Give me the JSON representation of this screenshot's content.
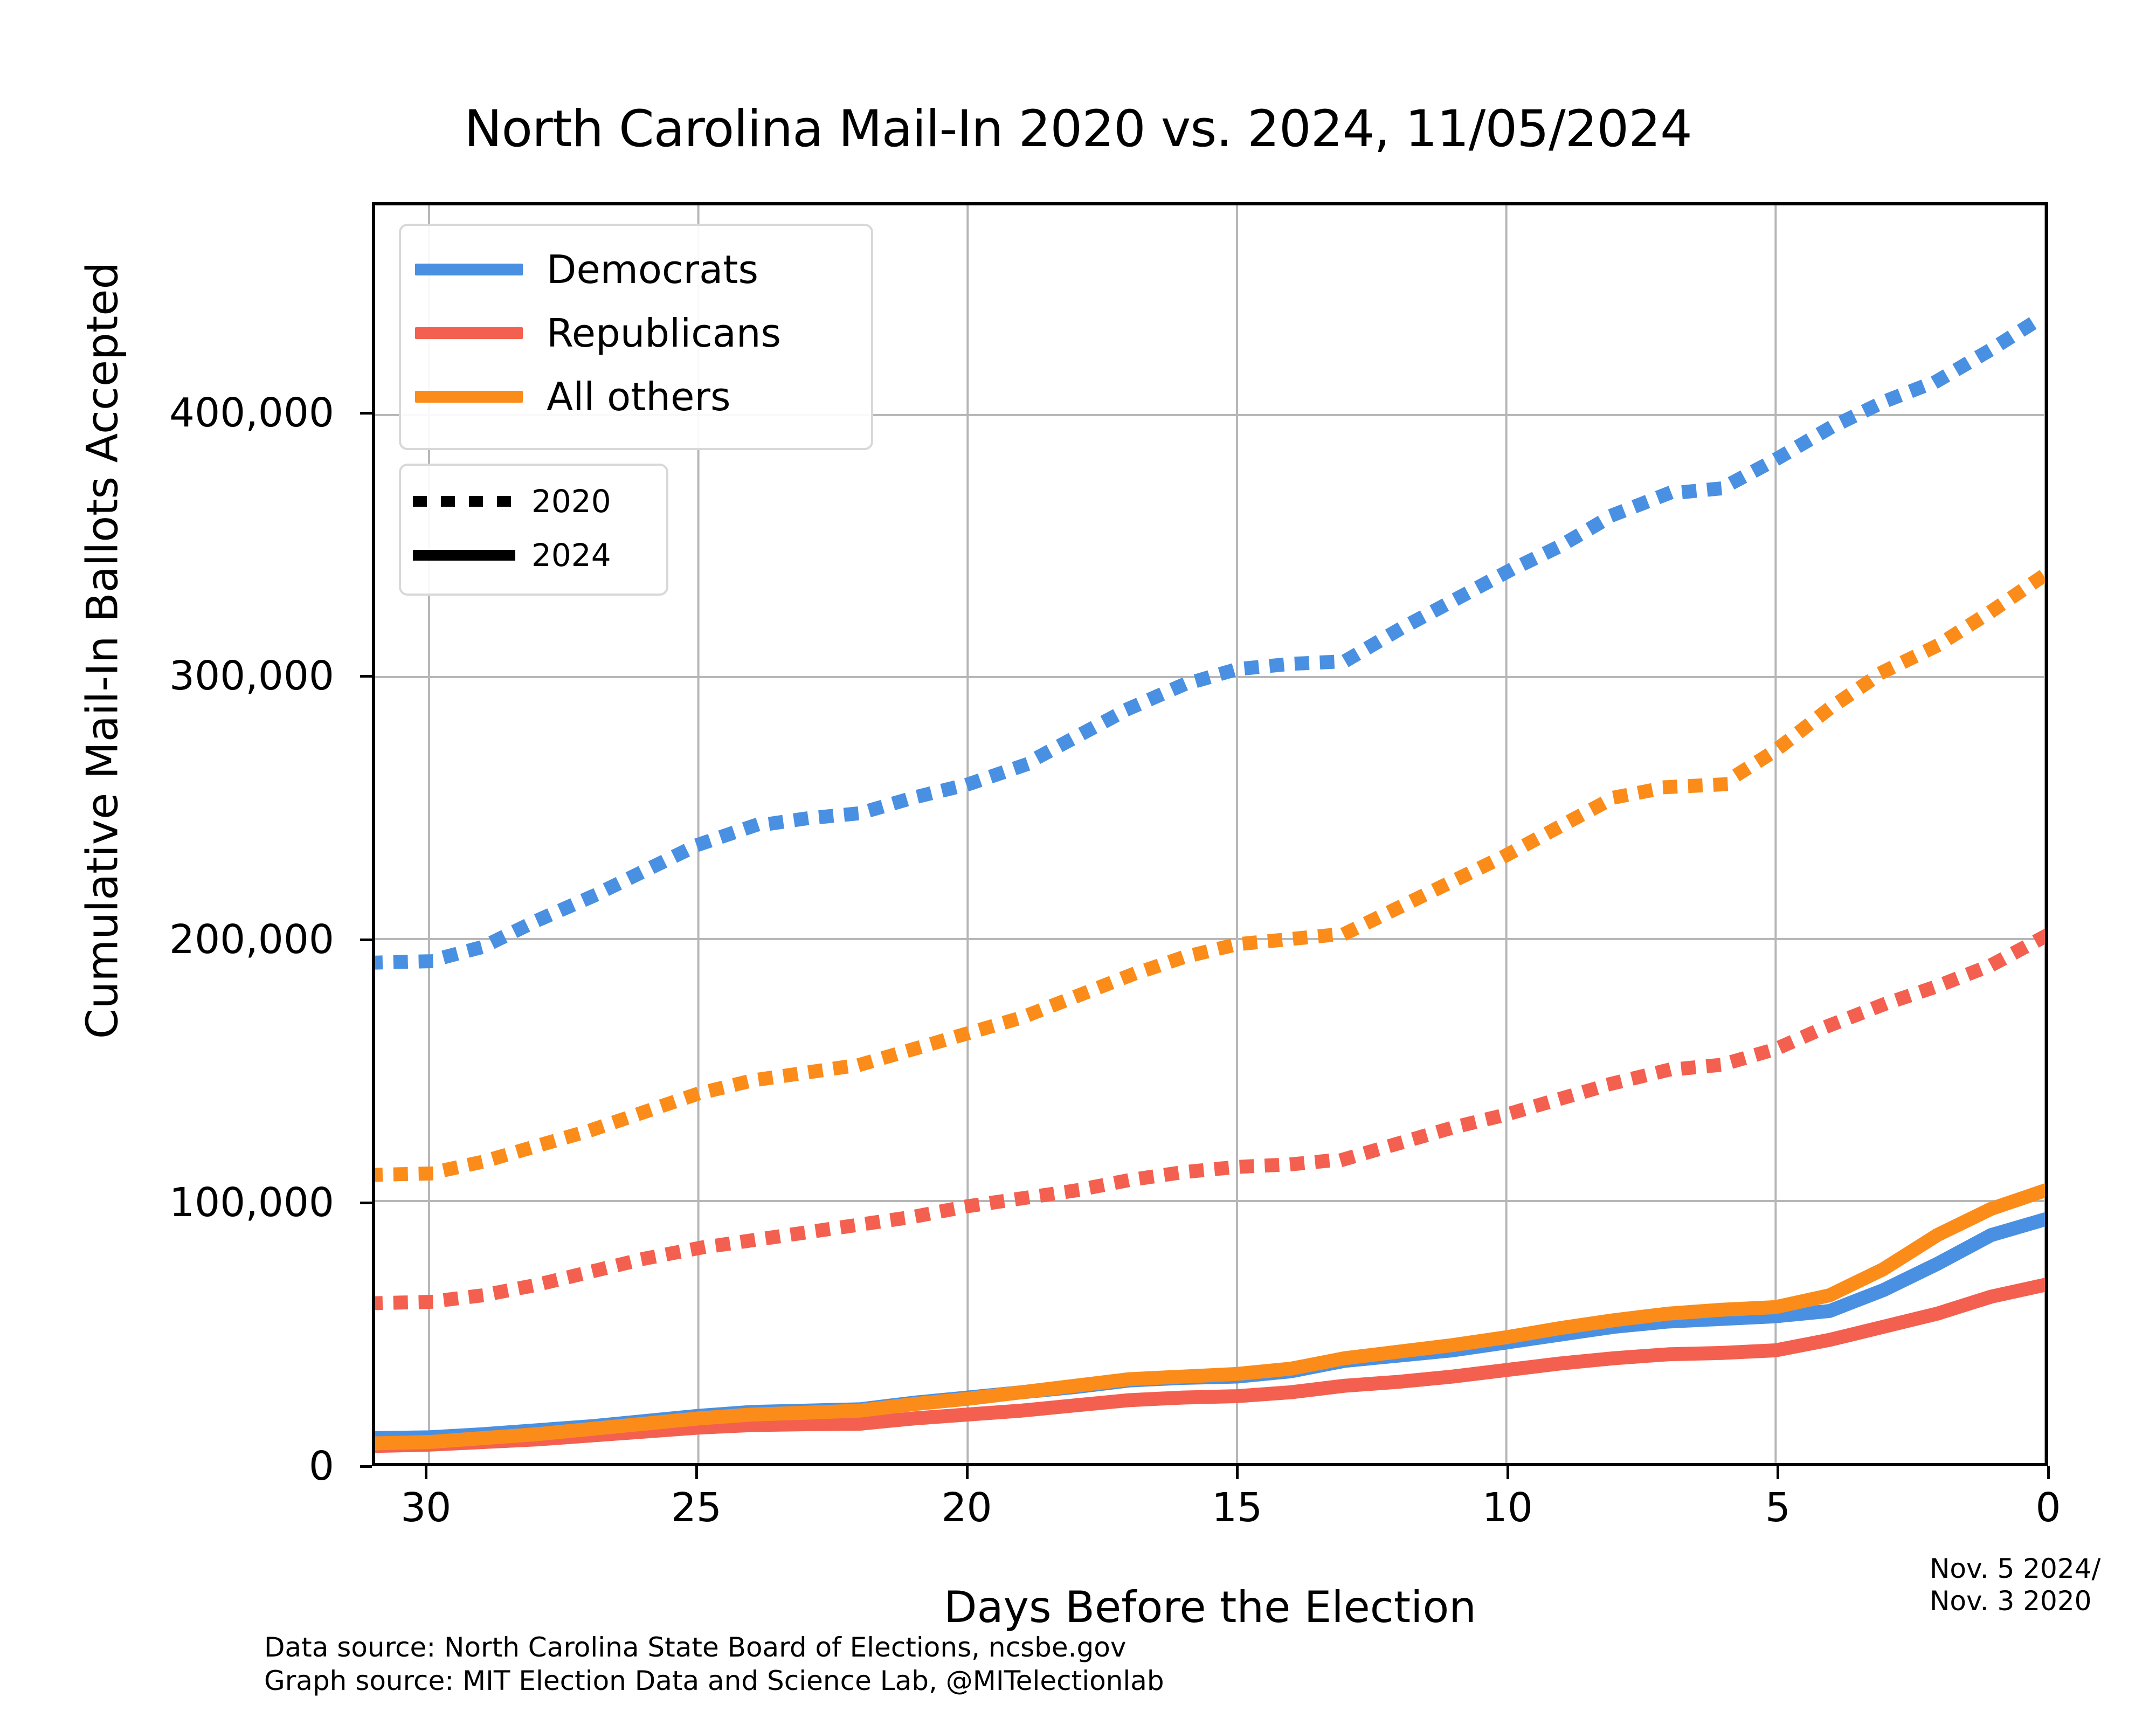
{
  "title": "North Carolina Mail-In 2020 vs. 2024, 11/05/2024",
  "axes": {
    "ylabel": "Cumulative Mail-In Ballots Accepted",
    "xlabel": "Days Before the Election"
  },
  "legend_color": {
    "items": [
      {
        "label": "Democrats",
        "color": "#4a90e2"
      },
      {
        "label": "Republicans",
        "color": "#f4604f"
      },
      {
        "label": "All others",
        "color": "#fb8c1a"
      }
    ]
  },
  "legend_style": {
    "items": [
      {
        "label": "2020",
        "style": "dotted"
      },
      {
        "label": "2024",
        "style": "solid"
      }
    ]
  },
  "annotations": {
    "election_date_line1": "Nov. 5 2024/",
    "election_date_line2": "Nov. 3 2020",
    "data_source": "Data source: North Carolina State Board of Elections, ncsbe.gov",
    "graph_source": "Graph source: MIT Election Data and Science Lab, @MITelectionlab"
  },
  "chart_data": {
    "type": "line",
    "title": "North Carolina Mail-In 2020 vs. 2024, 11/05/2024",
    "xlabel": "Days Before the Election",
    "ylabel": "Cumulative Mail-In Ballots Accepted",
    "xlim": [
      31,
      0
    ],
    "ylim": [
      0,
      480000
    ],
    "x_ticks": [
      30,
      25,
      20,
      15,
      10,
      5,
      0
    ],
    "x_tick_labels": [
      "30",
      "25",
      "20",
      "15",
      "10",
      "5",
      "0"
    ],
    "y_ticks": [
      0,
      100000,
      200000,
      300000,
      400000
    ],
    "y_tick_labels": [
      "0",
      "100,000",
      "200,000",
      "300,000",
      "400,000"
    ],
    "x_axis_inverted": true,
    "grid": true,
    "legend_position": "upper left",
    "x": [
      31,
      30,
      29,
      28,
      27,
      26,
      25,
      24,
      23,
      22,
      21,
      20,
      19,
      18,
      17,
      16,
      15,
      14,
      13,
      12,
      11,
      10,
      9,
      8,
      7,
      6,
      5,
      4,
      3,
      2,
      1,
      0
    ],
    "series": [
      {
        "name": "Democrats 2020",
        "color": "#4a90e2",
        "style": "dotted",
        "year": 2020,
        "values": [
          191000,
          191500,
          197000,
          207000,
          216000,
          226000,
          236000,
          243000,
          246000,
          248000,
          254000,
          259000,
          266000,
          277000,
          288000,
          297000,
          303000,
          305000,
          306000,
          318000,
          329000,
          340000,
          350000,
          362000,
          370000,
          372000,
          383000,
          395000,
          405000,
          413000,
          425000,
          438000
        ]
      },
      {
        "name": "Republicans 2020",
        "color": "#f4604f",
        "style": "dotted",
        "year": 2020,
        "values": [
          61000,
          61500,
          64000,
          68000,
          73000,
          78000,
          82000,
          85000,
          88000,
          91000,
          94000,
          98000,
          101000,
          104000,
          108000,
          111000,
          113000,
          114000,
          116000,
          122000,
          128000,
          133000,
          139000,
          145000,
          150000,
          152000,
          158000,
          167000,
          175000,
          182000,
          190000,
          201000
        ]
      },
      {
        "name": "All others 2020",
        "color": "#fb8c1a",
        "style": "dotted",
        "year": 2020,
        "values": [
          110000,
          110500,
          115000,
          121000,
          127000,
          134000,
          141000,
          146000,
          149000,
          152000,
          158000,
          164000,
          170000,
          178000,
          186000,
          193000,
          198000,
          200000,
          202000,
          212000,
          222000,
          232000,
          243000,
          254000,
          258000,
          259000,
          272000,
          288000,
          302000,
          312000,
          325000,
          339000
        ]
      },
      {
        "name": "Democrats 2024",
        "color": "#4a90e2",
        "style": "solid",
        "year": 2024,
        "values": [
          9500,
          9800,
          11000,
          12500,
          14000,
          16000,
          18000,
          19500,
          20000,
          20500,
          23000,
          25000,
          27000,
          29000,
          31500,
          32500,
          33000,
          35000,
          39000,
          41000,
          43000,
          46000,
          49000,
          52000,
          54000,
          55000,
          56000,
          58000,
          66000,
          76000,
          87000,
          93000
        ]
      },
      {
        "name": "Republicans 2024",
        "color": "#f4604f",
        "style": "solid",
        "year": 2024,
        "values": [
          6500,
          7000,
          8000,
          9000,
          10500,
          12000,
          13500,
          14500,
          14800,
          15000,
          17000,
          18500,
          20000,
          22000,
          24000,
          25000,
          25500,
          27000,
          29500,
          31000,
          33000,
          35500,
          38000,
          40000,
          41500,
          42000,
          43000,
          47000,
          52000,
          57000,
          63500,
          68000
        ]
      },
      {
        "name": "All others 2024",
        "color": "#fb8c1a",
        "style": "solid",
        "year": 2024,
        "values": [
          7500,
          8000,
          9500,
          11000,
          13000,
          15000,
          17000,
          18500,
          19200,
          20000,
          22500,
          24500,
          27000,
          29500,
          32000,
          33000,
          34000,
          36000,
          40000,
          42500,
          45000,
          48000,
          51500,
          54500,
          57000,
          58500,
          59500,
          64000,
          74000,
          87000,
          97000,
          104000
        ]
      }
    ]
  }
}
